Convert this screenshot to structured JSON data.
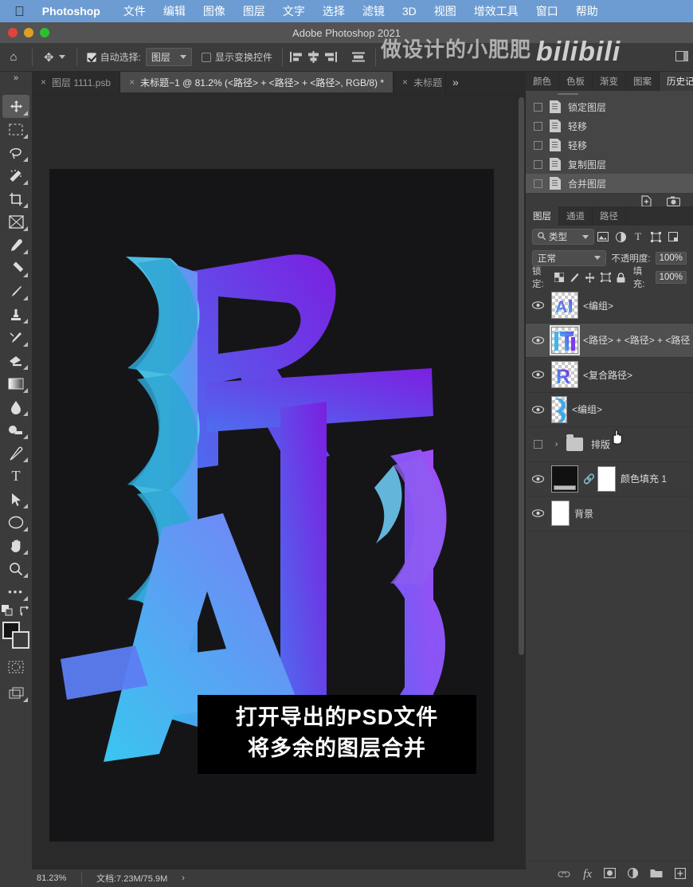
{
  "menubar": {
    "apple_icon": "apple-icon",
    "app_name": "Photoshop",
    "items": [
      "文件",
      "编辑",
      "图像",
      "图层",
      "文字",
      "选择",
      "滤镜",
      "3D",
      "视图",
      "增效工具",
      "窗口",
      "帮助"
    ]
  },
  "titlebar": {
    "title": "Adobe Photoshop 2021"
  },
  "watermark": {
    "text": "做设计的小肥肥",
    "logo": "bilibili"
  },
  "optionsbar": {
    "home_icon": "home-icon",
    "tool_icon": "move-tool-icon",
    "auto_select_checked": true,
    "auto_select_label": "自动选择:",
    "auto_select_value": "图层",
    "show_transform_checked": false,
    "show_transform_label": "显示变换控件",
    "align_icons": [
      "align-left-icon",
      "align-center-horizontal-icon",
      "align-right-icon",
      "align-top-icon"
    ]
  },
  "tabs": {
    "expand_icon": "expand-panels-icon",
    "items": [
      {
        "label": "图层 1111.psb",
        "active": false
      },
      {
        "label": "未标题−1 @ 81.2% (<路径> + <路径> + <路径>, RGB/8) *",
        "active": true
      },
      {
        "label": "未标题",
        "active": false
      }
    ],
    "more_icon": "more-tabs-icon"
  },
  "toolbar": {
    "tools": [
      {
        "name": "move-tool-icon",
        "glyph": "✥",
        "selected": true
      },
      {
        "name": "rectangular-marquee-tool-icon",
        "glyph": "▭",
        "selected": false
      },
      {
        "name": "lasso-tool-icon",
        "glyph": "✑",
        "selected": false
      },
      {
        "name": "magic-wand-tool-icon",
        "glyph": "✦",
        "selected": false
      },
      {
        "name": "crop-tool-icon",
        "glyph": "⌗",
        "selected": false
      },
      {
        "name": "frame-tool-icon",
        "glyph": "⊠",
        "selected": false
      },
      {
        "name": "eyedropper-tool-icon",
        "glyph": "⌇",
        "selected": false
      },
      {
        "name": "healing-brush-tool-icon",
        "glyph": "⟋",
        "selected": false
      },
      {
        "name": "brush-tool-icon",
        "glyph": "✎",
        "selected": false
      },
      {
        "name": "clone-stamp-tool-icon",
        "glyph": "⎙",
        "selected": false
      },
      {
        "name": "history-brush-tool-icon",
        "glyph": "✐",
        "selected": false
      },
      {
        "name": "eraser-tool-icon",
        "glyph": "◣",
        "selected": false
      },
      {
        "name": "gradient-tool-icon",
        "glyph": "▦",
        "selected": false
      },
      {
        "name": "blur-tool-icon",
        "glyph": "💧",
        "selected": false
      },
      {
        "name": "dodge-tool-icon",
        "glyph": "✋",
        "selected": false
      },
      {
        "name": "pen-tool-icon",
        "glyph": "✒",
        "selected": false
      },
      {
        "name": "type-tool-icon",
        "glyph": "T",
        "selected": false
      },
      {
        "name": "path-selection-tool-icon",
        "glyph": "➤",
        "selected": false
      },
      {
        "name": "ellipse-tool-icon",
        "glyph": "◯",
        "selected": false
      },
      {
        "name": "hand-tool-icon",
        "glyph": "✋",
        "selected": false
      },
      {
        "name": "zoom-tool-icon",
        "glyph": "🔍",
        "selected": false
      },
      {
        "name": "edit-toolbar-icon",
        "glyph": "•••",
        "selected": false
      }
    ],
    "default_colors_icon": "default-colors-icon",
    "swap_colors_icon": "swap-colors-icon",
    "foreground_color": "#141414",
    "background_color": "#ffffff",
    "quickmask_icon": "quick-mask-icon",
    "screenmode_icon": "screen-mode-icon"
  },
  "canvas": {
    "artwork_alt": "RBTAI gradient typography artwork",
    "background_color": "#151518",
    "caption_lines": [
      "打开导出的PSD文件",
      "将多余的图层合并"
    ]
  },
  "statusbar": {
    "zoom": "81.23%",
    "doc_info": "文档:7.23M/75.9M",
    "expand_icon": "chevron-right-icon"
  },
  "right_panel": {
    "top_tabs": [
      {
        "label": "颜色",
        "active": false
      },
      {
        "label": "色板",
        "active": false
      },
      {
        "label": "渐变",
        "active": false
      },
      {
        "label": "图案",
        "active": false
      },
      {
        "label": "历史记录",
        "active": true
      }
    ],
    "history": {
      "items": [
        {
          "label": "锁定图层",
          "selected": false
        },
        {
          "label": "轻移",
          "selected": false
        },
        {
          "label": "轻移",
          "selected": false
        },
        {
          "label": "复制图层",
          "selected": false
        },
        {
          "label": "合并图层",
          "selected": true
        }
      ],
      "footer_icons": [
        "new-document-from-state-icon",
        "create-snapshot-icon"
      ]
    },
    "layers": {
      "tabs": [
        {
          "label": "图层",
          "active": true
        },
        {
          "label": "通道",
          "active": false
        },
        {
          "label": "路径",
          "active": false
        }
      ],
      "filter": {
        "search_icon": "search-icon",
        "kind_label": "类型",
        "icons": [
          "filter-pixel-icon",
          "filter-adjustment-icon",
          "filter-type-icon",
          "filter-shape-icon",
          "filter-smart-object-icon"
        ]
      },
      "blend_mode": "正常",
      "opacity_label": "不透明度:",
      "opacity_value": "100%",
      "lock_label": "锁定:",
      "lock_icons": [
        "lock-transparent-pixels-icon",
        "lock-image-pixels-icon",
        "lock-position-icon",
        "lock-artboard-icon",
        "lock-all-icon"
      ],
      "fill_label": "填充:",
      "fill_value": "100%",
      "rows": [
        {
          "name": "<编组>",
          "visible": true,
          "selected": false,
          "type": "layer",
          "thumb": "ai-letters"
        },
        {
          "name": "<路径> + <路径> + <路径",
          "visible": true,
          "selected": true,
          "type": "layer",
          "thumb": "bt-letters"
        },
        {
          "name": "<复合路径>",
          "visible": true,
          "selected": false,
          "type": "layer",
          "thumb": "r-letter"
        },
        {
          "name": "<编组>",
          "visible": true,
          "selected": false,
          "type": "layer",
          "thumb": "ribbon"
        },
        {
          "name": "排版",
          "visible": false,
          "selected": false,
          "type": "group",
          "thumb": "folder"
        },
        {
          "name": "颜色填充 1",
          "visible": true,
          "selected": false,
          "type": "fill",
          "thumb": "black-fill",
          "mask": "white-mask",
          "link_icon": "link-icon"
        },
        {
          "name": "背景",
          "visible": true,
          "selected": false,
          "type": "background",
          "thumb": "white"
        }
      ],
      "footer_icons": [
        "link-layers-icon",
        "layer-style-icon",
        "add-layer-mask-icon",
        "new-adjustment-layer-icon",
        "new-group-icon",
        "new-layer-icon"
      ]
    }
  },
  "colors": {
    "menubar_bg": "#6c9cd2",
    "panel_bg": "#3b3b3b",
    "canvas_bg": "#2a2a2a",
    "accent_blue": "#3fa9f5",
    "accent_purple": "#7b2ff7"
  }
}
